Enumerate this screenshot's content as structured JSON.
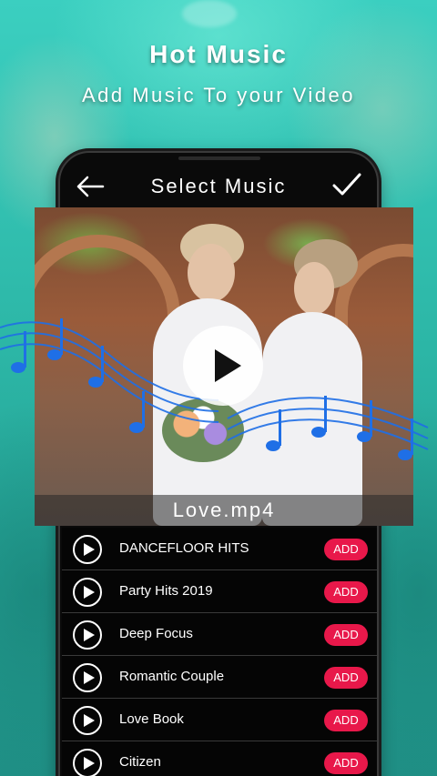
{
  "header": {
    "title": "Hot Music",
    "subtitle": "Add Music To your Video"
  },
  "topbar": {
    "title": "Select Music",
    "back_icon": "arrow-left-icon",
    "confirm_icon": "checkmark-icon"
  },
  "video": {
    "filename": "Love.mp4",
    "play_icon": "play-icon"
  },
  "tracks": [
    {
      "name": "DANCEFLOOR HITS",
      "action": "ADD"
    },
    {
      "name": "Party Hits 2019",
      "action": "ADD"
    },
    {
      "name": "Deep Focus",
      "action": "ADD"
    },
    {
      "name": "Romantic Couple",
      "action": "ADD"
    },
    {
      "name": "Love Book",
      "action": "ADD"
    },
    {
      "name": "Citizen",
      "action": "ADD"
    }
  ],
  "colors": {
    "accent": "#e8184a",
    "background": "#2fbfae",
    "notes": "#1f6fe6"
  }
}
